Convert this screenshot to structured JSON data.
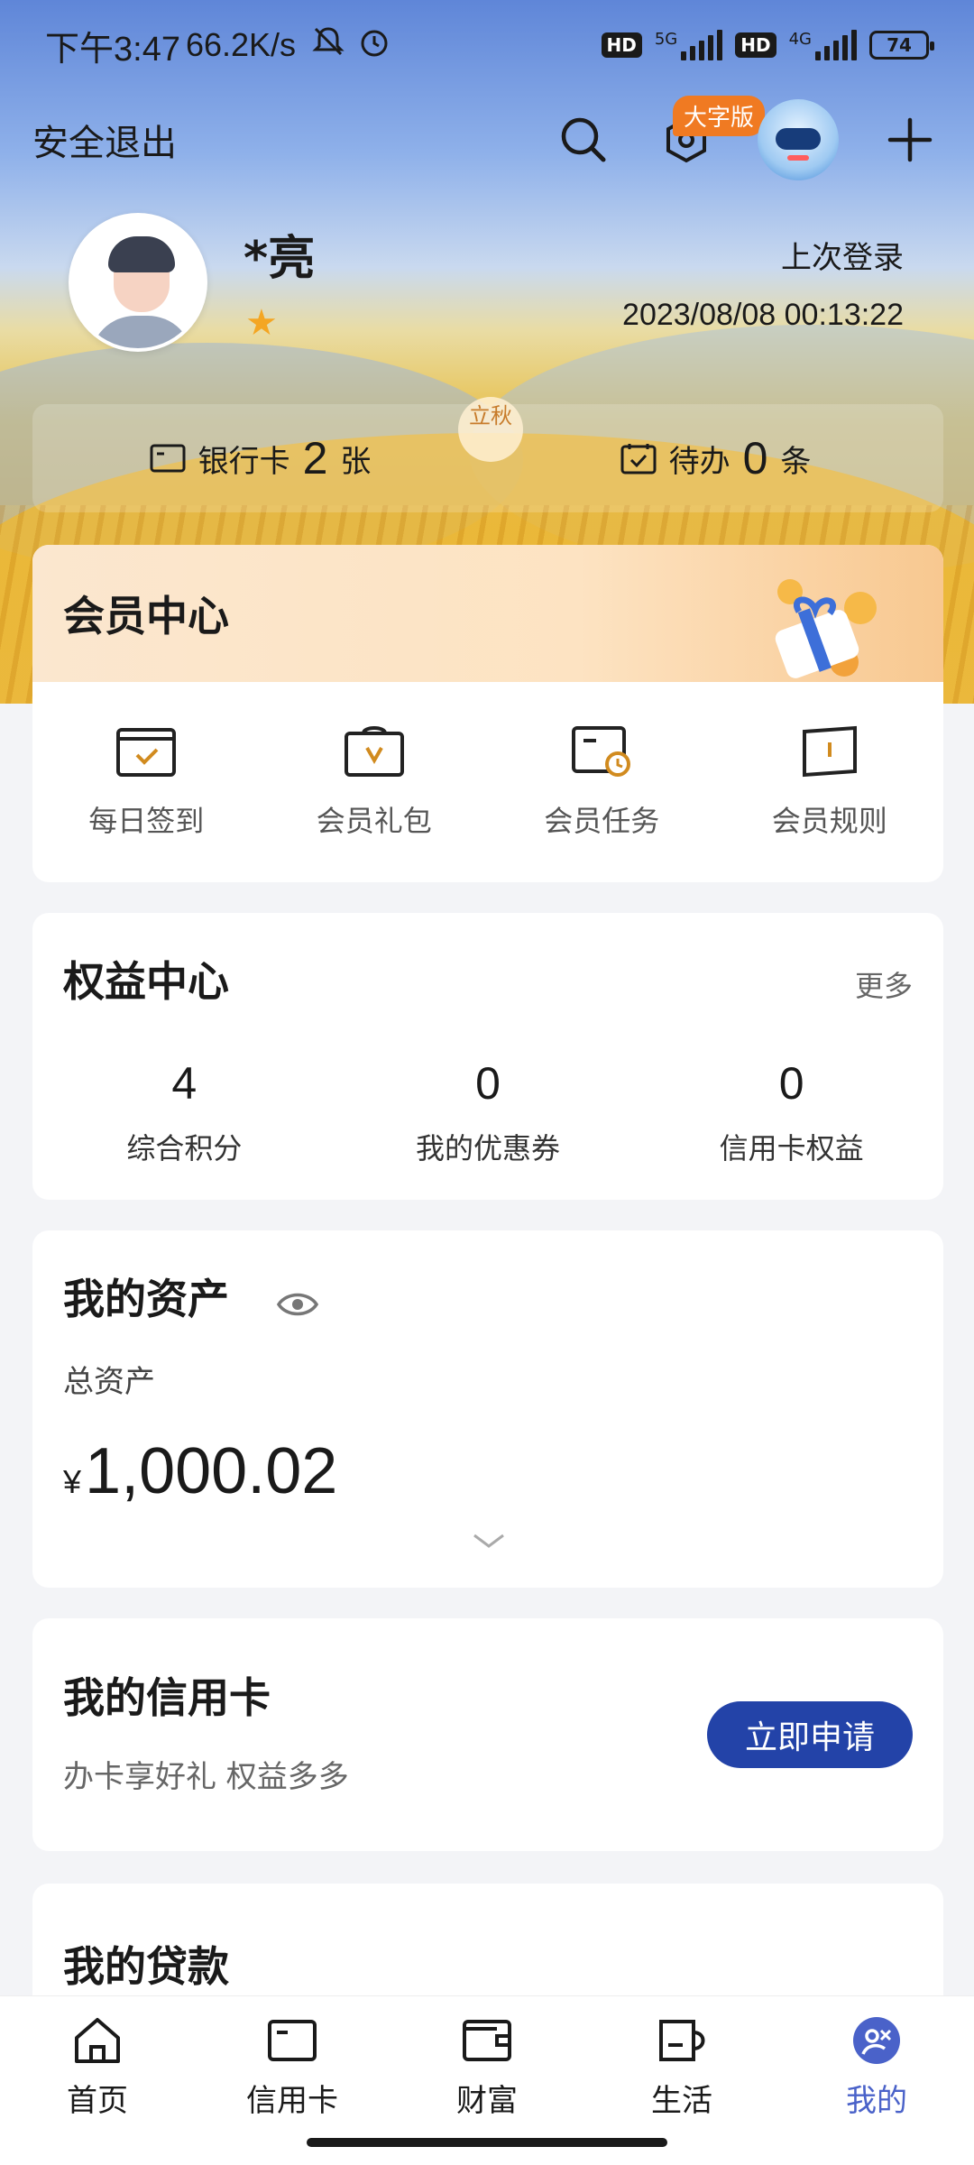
{
  "status_bar": {
    "time": "下午3:47",
    "net_speed": "66.2K/s",
    "hd1": "HD",
    "net1": "5G",
    "hd2": "HD",
    "net2": "4G",
    "battery": "74"
  },
  "header": {
    "logout": "安全退出",
    "big_font_badge": "大字版"
  },
  "profile": {
    "name": "*亮",
    "last_login_label": "上次登录",
    "last_login_time": "2023/08/08 00:13:22"
  },
  "summary": {
    "card_label": "银行卡",
    "card_count": "2",
    "card_unit": "张",
    "todo_label": "待办",
    "todo_count": "0",
    "todo_unit": "条",
    "solar_term": "立秋"
  },
  "member": {
    "title": "会员中心",
    "items": [
      {
        "label": "每日签到",
        "icon": "calendar-check-icon"
      },
      {
        "label": "会员礼包",
        "icon": "gift-bag-icon"
      },
      {
        "label": "会员任务",
        "icon": "task-clock-icon"
      },
      {
        "label": "会员规则",
        "icon": "rule-book-icon"
      }
    ]
  },
  "rights": {
    "title": "权益中心",
    "more": "更多",
    "items": [
      {
        "value": "4",
        "label": "综合积分"
      },
      {
        "value": "0",
        "label": "我的优惠券"
      },
      {
        "value": "0",
        "label": "信用卡权益"
      }
    ]
  },
  "assets": {
    "title": "我的资产",
    "total_label": "总资产",
    "currency": "¥",
    "total": "1,000.02"
  },
  "credit": {
    "title": "我的信用卡",
    "subtitle": "办卡享好礼 权益多多",
    "apply": "立即申请"
  },
  "loan": {
    "title": "我的贷款"
  },
  "tabbar": {
    "items": [
      {
        "label": "首页",
        "icon": "home-icon"
      },
      {
        "label": "信用卡",
        "icon": "credit-card-icon"
      },
      {
        "label": "财富",
        "icon": "wallet-icon"
      },
      {
        "label": "生活",
        "icon": "cup-icon"
      },
      {
        "label": "我的",
        "icon": "profile-icon"
      }
    ]
  },
  "colors": {
    "accent": "#2343a8",
    "tab_active": "#4a62c9",
    "badge": "#f07a22"
  }
}
